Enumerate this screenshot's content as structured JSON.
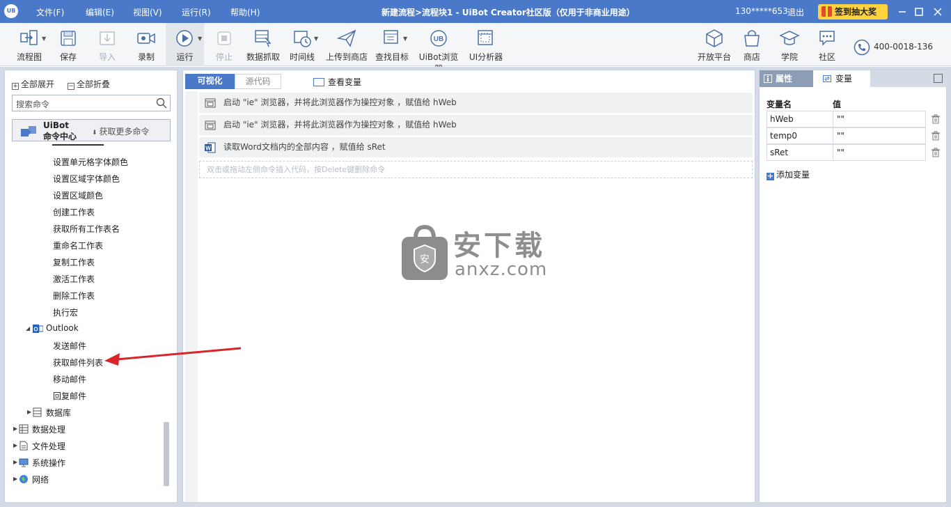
{
  "titlebar": {
    "logo": "UB",
    "menus": [
      "文件(F)",
      "编辑(E)",
      "视图(V)",
      "运行(R)",
      "帮助(H)"
    ],
    "title": "新建流程>流程块1 - UiBot Creator社区版（仅用于非商业用途）",
    "user": "130*****653",
    "logout": "退出",
    "lottery": "签到抽大奖"
  },
  "toolbar": {
    "items": [
      {
        "label": "流程图",
        "icon": "flowchart-icon",
        "dropdown": true
      },
      {
        "label": "保存",
        "icon": "save-icon"
      },
      {
        "label": "导入",
        "icon": "import-icon",
        "disabled": true
      },
      {
        "label": "录制",
        "icon": "record-icon"
      },
      {
        "label": "运行",
        "icon": "run-icon",
        "dropdown": true
      },
      {
        "label": "停止",
        "icon": "stop-icon",
        "disabled": true
      },
      {
        "label": "数据抓取",
        "icon": "data-scrape-icon"
      },
      {
        "label": "时间线",
        "icon": "timeline-icon",
        "dropdown": true
      },
      {
        "label": "上传到商店",
        "icon": "upload-icon"
      },
      {
        "label": "查找目标",
        "icon": "find-target-icon",
        "dropdown": true
      },
      {
        "label": "UiBot浏览器",
        "icon": "uibot-browser-icon"
      },
      {
        "label": "UI分析器",
        "icon": "ui-analyzer-icon"
      }
    ],
    "right_items": [
      {
        "label": "开放平台",
        "icon": "open-platform-icon"
      },
      {
        "label": "商店",
        "icon": "store-icon"
      },
      {
        "label": "学院",
        "icon": "academy-icon"
      },
      {
        "label": "社区",
        "icon": "community-icon"
      }
    ],
    "phone": "400-0018-136"
  },
  "left": {
    "expand_all": "全部展开",
    "collapse_all": "全部折叠",
    "search_placeholder": "搜索命令",
    "cmd_center_line1": "UiBot",
    "cmd_center_line2": "命令中心",
    "get_more": "获取更多命令",
    "excel_items": [
      "设置单元格字体颜色",
      "设置区域字体颜色",
      "设置区域颜色",
      "创建工作表",
      "获取所有工作表名",
      "重命名工作表",
      "复制工作表",
      "激活工作表",
      "删除工作表",
      "执行宏"
    ],
    "outlook": "Outlook",
    "outlook_items": [
      "发送邮件",
      "获取邮件列表",
      "移动邮件",
      "回复邮件"
    ],
    "database": "数据库",
    "top_level": [
      "数据处理",
      "文件处理",
      "系统操作",
      "网络"
    ]
  },
  "editor": {
    "tab_visual": "可视化",
    "tab_source": "源代码",
    "view_vars": "查看变量",
    "commands": [
      "启动 \"ie\" 浏览器，并将此浏览器作为操控对象 ，赋值给 hWeb",
      "启动 \"ie\" 浏览器，并将此浏览器作为操控对象 ，赋值给 hWeb",
      "读取Word文档内的全部内容 ，赋值给 sRet"
    ],
    "drop_hint": "双击或拖动左侧命令插入代码，按Delete键删除命令",
    "watermark": "安下载",
    "watermark_sub": "anxz.com"
  },
  "right": {
    "tab_props": "属性",
    "tab_vars": "变量",
    "col_name": "变量名",
    "col_value": "值",
    "variables": [
      {
        "name": "hWeb",
        "value": "\"\""
      },
      {
        "name": "temp0",
        "value": "\"\""
      },
      {
        "name": "sRet",
        "value": "\"\""
      }
    ],
    "add_var": "添加变量"
  },
  "colors": {
    "accent": "#4a79c9",
    "titlebar": "#4a79c9",
    "lottery": "#ffd23f",
    "arrow": "#d8252a"
  }
}
